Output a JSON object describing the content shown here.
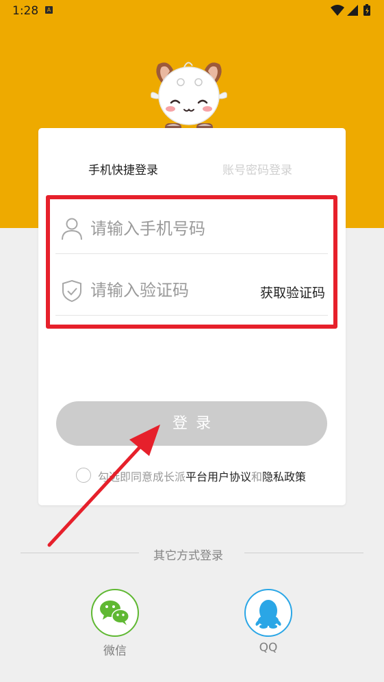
{
  "status_bar": {
    "time": "1:28",
    "notification_icon": "A"
  },
  "tabs": {
    "quick_login": "手机快捷登录",
    "password_login": "账号密码登录"
  },
  "phone_field": {
    "placeholder": "请输入手机号码",
    "value": ""
  },
  "code_field": {
    "placeholder": "请输入验证码",
    "value": "",
    "get_code_label": "获取验证码"
  },
  "login_button": {
    "label": "登录"
  },
  "agreement": {
    "prefix": "勾选即同意成长派",
    "user_agreement": "平台用户协议",
    "and": "和",
    "privacy_policy": "隐私政策"
  },
  "other_login": {
    "title": "其它方式登录",
    "wechat_label": "微信",
    "qq_label": "QQ"
  },
  "colors": {
    "brand": "#eeaa00",
    "highlight": "#e6202b",
    "wechat": "#5fb832",
    "qq": "#2aa6e6"
  }
}
